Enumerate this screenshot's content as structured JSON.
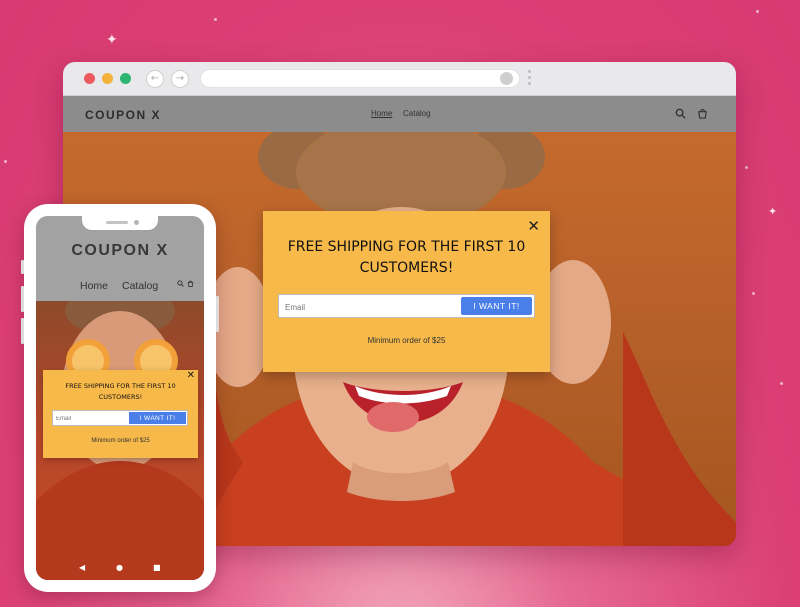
{
  "desktop": {
    "toolbar": {
      "back_glyph": "←",
      "forward_glyph": "→",
      "url": ""
    },
    "site": {
      "brand": "COUPON X",
      "nav": [
        "Home",
        "Catalog"
      ],
      "icons": [
        "search-icon",
        "cart-icon"
      ]
    },
    "popup": {
      "close": "✕",
      "title": "FREE SHIPPING FOR THE FIRST 10 CUSTOMERS!",
      "email_placeholder": "Email",
      "button": "I WANT IT!",
      "note": "Minimum order of $25"
    }
  },
  "mobile": {
    "site": {
      "brand": "COUPON X",
      "nav": [
        "Home",
        "Catalog"
      ],
      "icons": [
        "search-icon",
        "cart-icon"
      ]
    },
    "popup": {
      "close": "✕",
      "title": "FREE SHIPPING FOR THE FIRST 10 CUSTOMERS!",
      "email_placeholder": "Email",
      "button": "I WANT IT!",
      "note": "Minimum order of $25"
    },
    "nav_buttons": {
      "back": "◀",
      "home": "●",
      "recent": "■"
    }
  },
  "colors": {
    "background": "#db3f74",
    "popup": "#f7b94a",
    "button": "#4a7ee8",
    "traffic_red": "#ec5a5f",
    "traffic_yellow": "#f2b23c",
    "traffic_green": "#2bb673"
  }
}
